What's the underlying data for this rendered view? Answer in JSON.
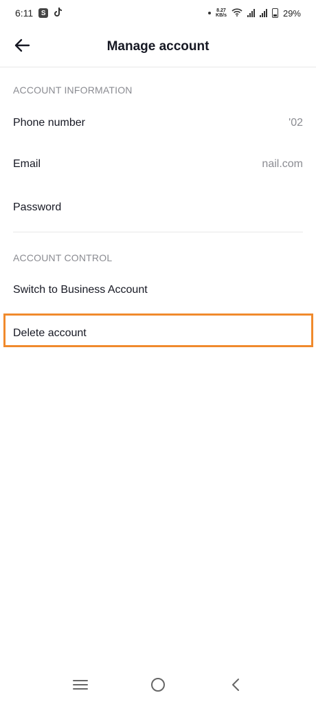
{
  "status_bar": {
    "time": "6:11",
    "net_speed_top": "8.27",
    "net_speed_bottom": "KB/s",
    "battery": "29%"
  },
  "header": {
    "title": "Manage account",
    "back_icon": "arrow-left-icon"
  },
  "account_information": {
    "label": "ACCOUNT INFORMATION",
    "rows": [
      {
        "label": "Phone number",
        "value": "'02"
      },
      {
        "label": "Email",
        "value": "nail.com"
      },
      {
        "label": "Password",
        "value": ""
      }
    ]
  },
  "account_control": {
    "label": "ACCOUNT CONTROL",
    "rows": [
      {
        "label": "Switch to Business Account"
      },
      {
        "label": "Delete account"
      }
    ]
  },
  "highlight_color": "#f08a2c",
  "nav_bar": {
    "icons": [
      "menu-icon",
      "home-circle-icon",
      "back-chevron-icon"
    ]
  }
}
